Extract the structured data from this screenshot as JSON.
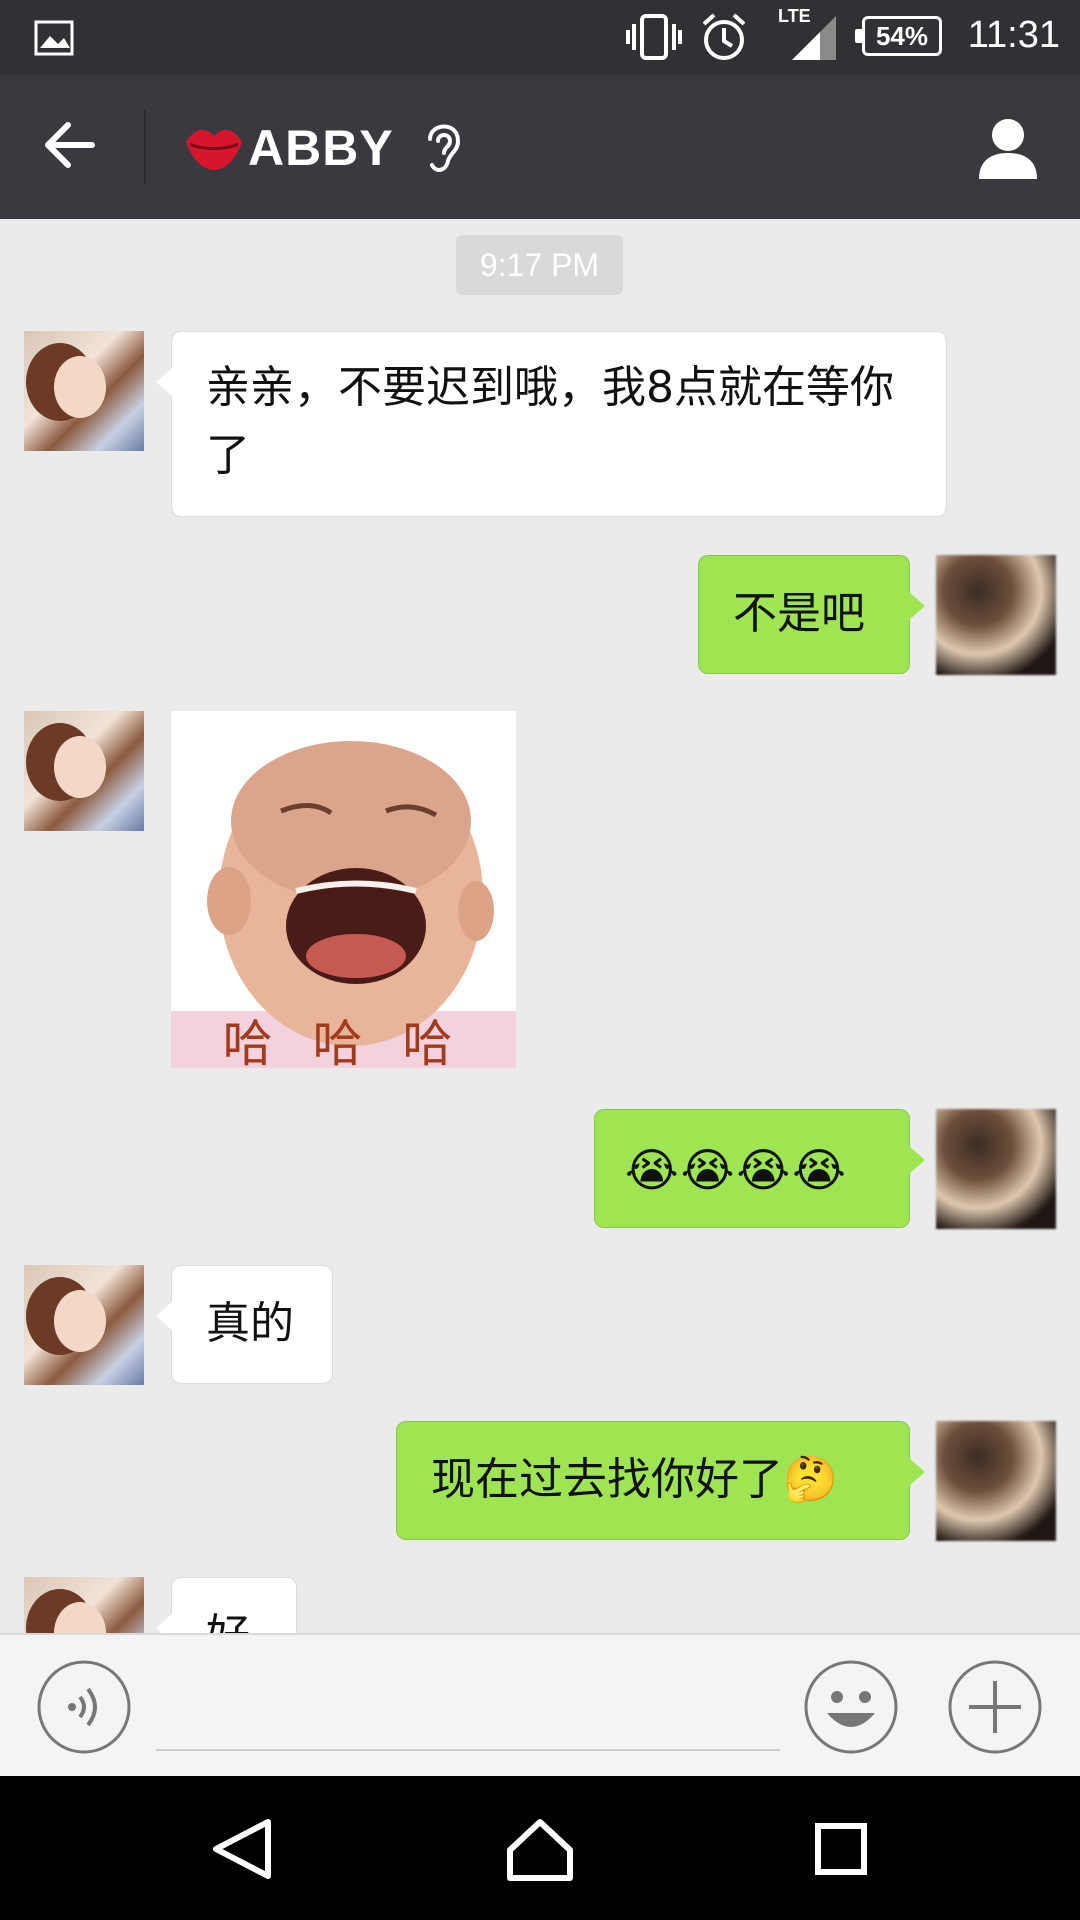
{
  "status_bar": {
    "time": "11:31",
    "battery": "54%",
    "network": "LTE"
  },
  "header": {
    "contact_name": "ABBY"
  },
  "chat": {
    "timestamp": "9:17 PM",
    "messages": [
      {
        "direction": "in",
        "text": "亲亲，不要迟到哦，我8点就在等你了"
      },
      {
        "direction": "out",
        "text": "不是吧"
      },
      {
        "direction": "in",
        "type": "sticker",
        "caption": "哈 哈 哈"
      },
      {
        "direction": "out",
        "text": "😭😭😭😭"
      },
      {
        "direction": "in",
        "text": "真的"
      },
      {
        "direction": "out",
        "text": "现在过去找你好了🤔"
      },
      {
        "direction": "in",
        "text": "好"
      }
    ]
  },
  "icons": {
    "back": "back-arrow-icon",
    "ear": "ear-icon",
    "profile": "profile-icon",
    "voice": "voice-icon",
    "emoji": "emoji-icon",
    "plus": "plus-icon"
  },
  "colors": {
    "titlebar": "#393a3f",
    "chat_bg": "#ebebeb",
    "bubble_out": "#9ee551",
    "bubble_in": "#ffffff"
  }
}
